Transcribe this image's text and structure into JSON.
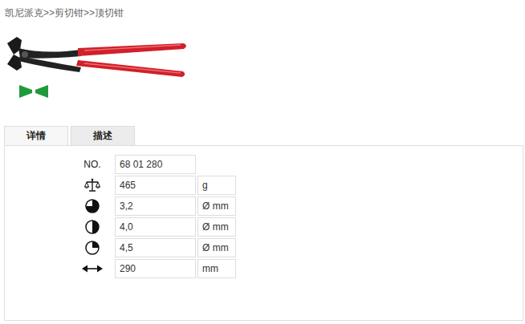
{
  "breadcrumb": {
    "items": [
      "凯尼派克",
      "剪切钳",
      "顶切钳"
    ],
    "separator": ">>"
  },
  "tabs": [
    {
      "label": "详情",
      "selected": true
    },
    {
      "label": "描述",
      "selected": false
    }
  ],
  "specs": [
    {
      "kind": "number",
      "label": "NO.",
      "value": "68 01 280"
    },
    {
      "kind": "weight",
      "value": "465",
      "unit": "g"
    },
    {
      "kind": "hard",
      "value": "3,2",
      "unit": "Ø mm"
    },
    {
      "kind": "medium",
      "value": "4,0",
      "unit": "Ø mm"
    },
    {
      "kind": "soft",
      "value": "4,5",
      "unit": "Ø mm"
    },
    {
      "kind": "length",
      "value": "290",
      "unit": "mm"
    }
  ]
}
